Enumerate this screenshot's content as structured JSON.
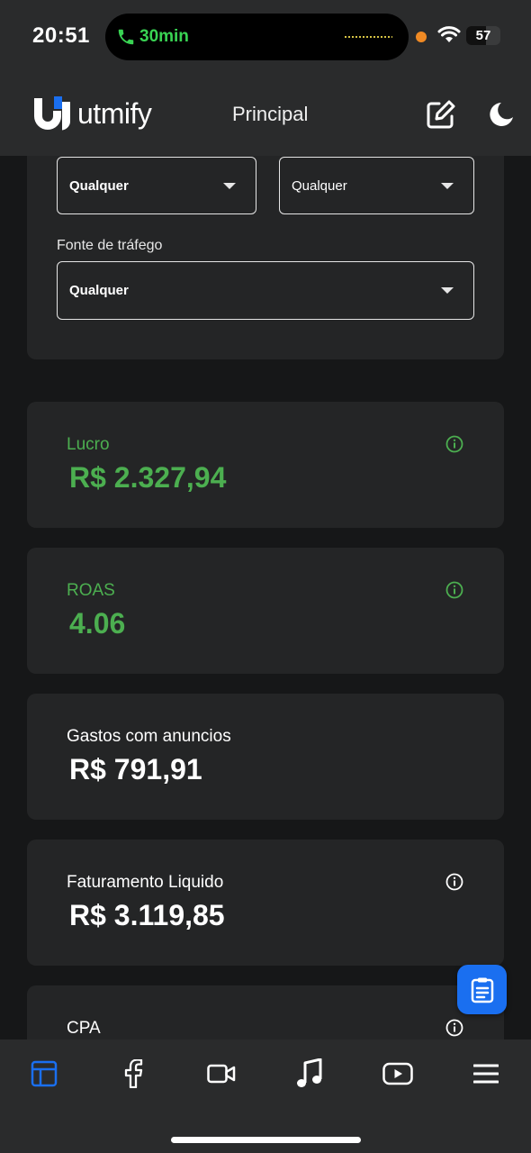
{
  "status_bar": {
    "time": "20:51",
    "call_timer": "30min",
    "battery_level": "57",
    "battery_fraction": 0.57
  },
  "header": {
    "brand": "utmify",
    "title": "Principal"
  },
  "filters": {
    "select_1": "Qualquer",
    "select_2": "Qualquer",
    "traffic_source_label": "Fonte de tráfego",
    "traffic_source_value": "Qualquer"
  },
  "metrics": [
    {
      "label": "Lucro",
      "value": "R$ 2.327,94",
      "color": "#4caf50"
    },
    {
      "label": "ROAS",
      "value": "4.06",
      "color": "#4caf50"
    },
    {
      "label": "Gastos com anuncios",
      "value": "R$ 791,91",
      "color": "#ffffff"
    },
    {
      "label": "Faturamento Liquido",
      "value": "R$ 3.119,85",
      "color": "#ffffff"
    },
    {
      "label": "CPA",
      "value": "",
      "color": "#ffffff"
    }
  ],
  "nav": {
    "items": [
      "dashboard-icon",
      "facebook-icon",
      "video-icon",
      "music-icon",
      "youtube-icon",
      "menu-icon"
    ],
    "active_color": "#1a6ff0"
  }
}
